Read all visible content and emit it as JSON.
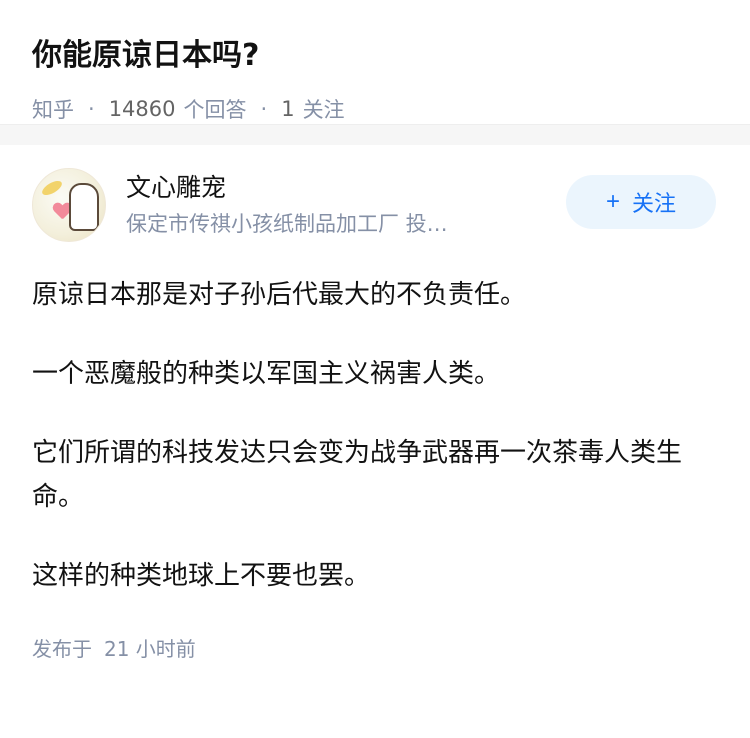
{
  "question": {
    "title": "你能原谅日本吗?",
    "source": "知乎",
    "answer_count": "14860",
    "answer_label": "个回答",
    "follow_count": "1",
    "follow_label": "关注"
  },
  "answer": {
    "author_name": "文心雕宠",
    "author_bio": "保定市传祺小孩纸制品加工厂 投…",
    "follow_button": "关注",
    "follow_icon": "+",
    "paragraphs": [
      "原谅日本那是对子孙后代最大的不负责任。",
      "一个恶魔般的种类以军国主义祸害人类。",
      "它们所谓的科技发达只会变为战争武器再一次茶毒人类生命。",
      "这样的种类地球上不要也罢。"
    ],
    "published_label": "发布于",
    "published_time": "21 小时前"
  }
}
